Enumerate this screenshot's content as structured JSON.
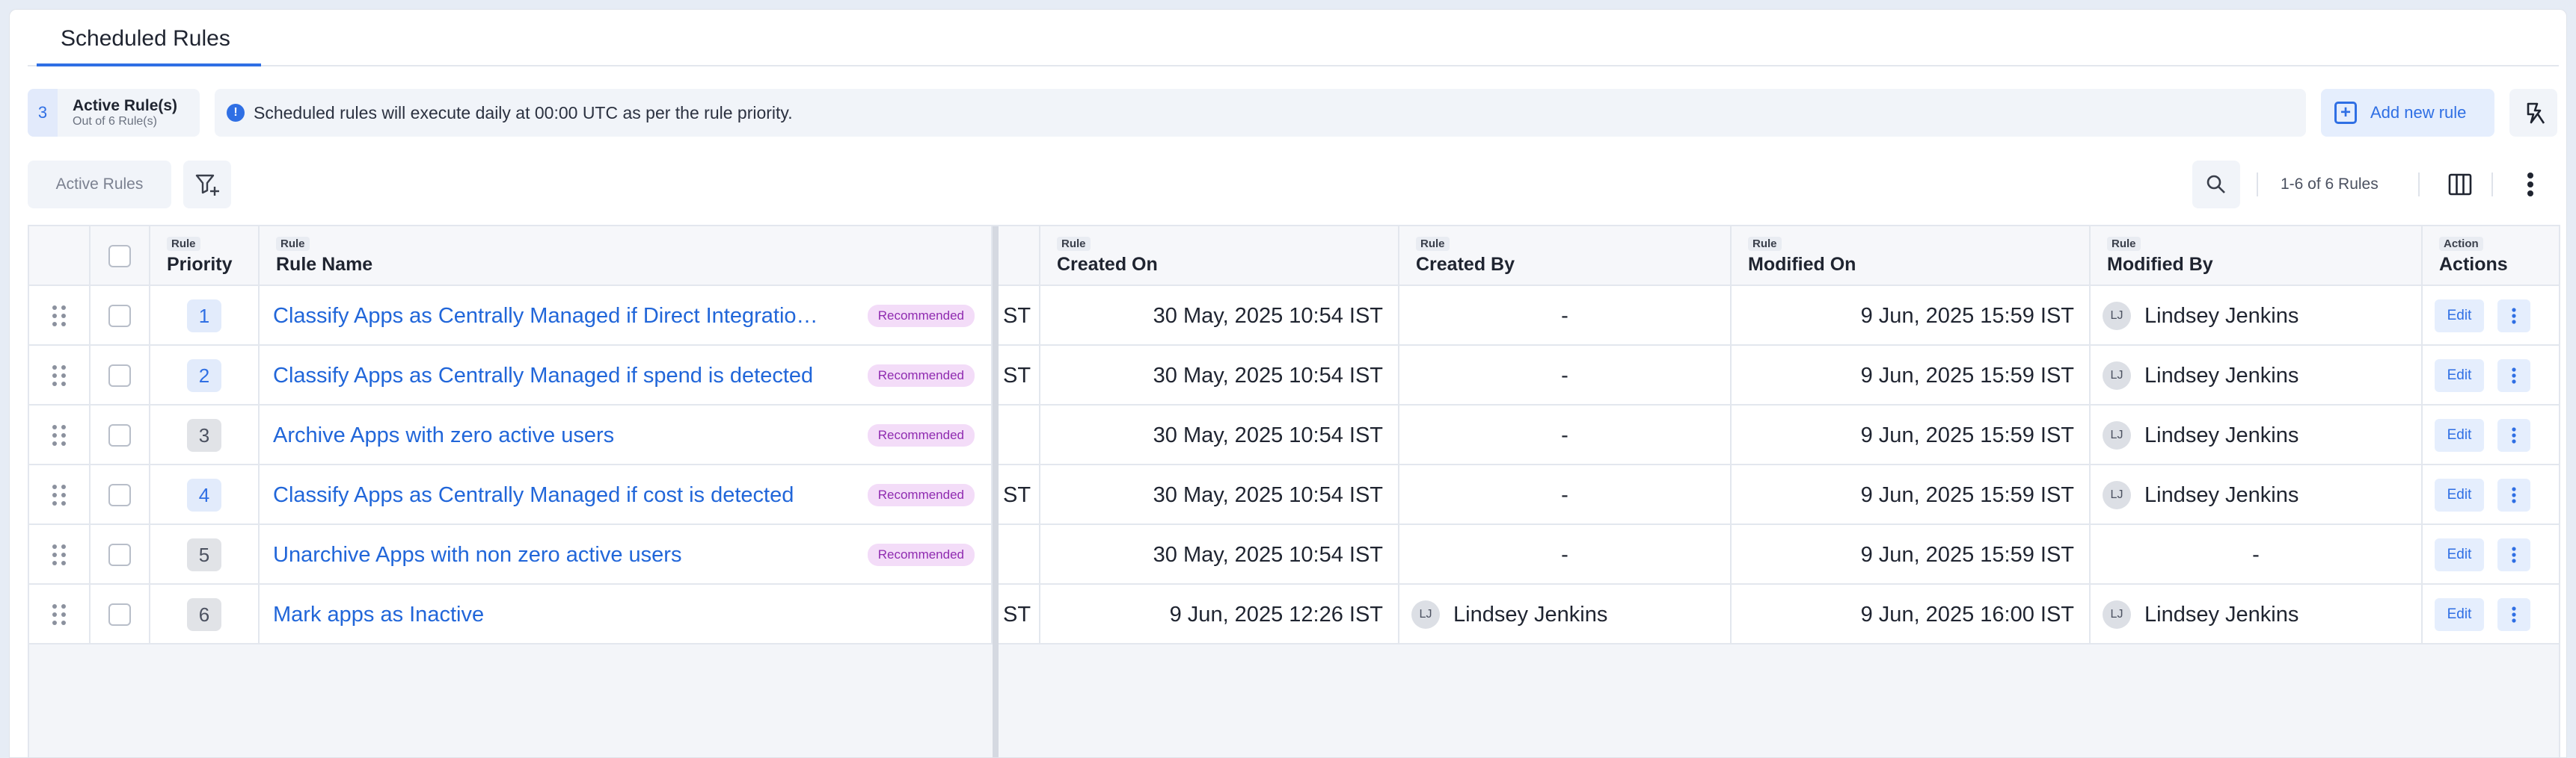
{
  "tabs": [
    {
      "label": "Scheduled Rules",
      "active": true
    }
  ],
  "summary": {
    "count": "3",
    "title": "Active Rule(s)",
    "subtitle": "Out of 6 Rule(s)"
  },
  "info": {
    "icon": "info-icon",
    "text": "Scheduled rules will execute daily at 00:00 UTC as per the rule priority."
  },
  "toolbar": {
    "add_label": "Add new rule",
    "filter_chip": "Active Rules",
    "pagination": "1-6 of 6 Rules"
  },
  "columns": {
    "priority": {
      "group": "Rule",
      "title": "Priority"
    },
    "name": {
      "group": "Rule",
      "title": "Rule Name"
    },
    "created_on": {
      "group": "Rule",
      "title": "Created On"
    },
    "created_by": {
      "group": "Rule",
      "title": "Created By"
    },
    "modified_on": {
      "group": "Rule",
      "title": "Modified On"
    },
    "modified_by": {
      "group": "Rule",
      "title": "Modified By"
    },
    "actions": {
      "group": "Action",
      "title": "Actions"
    }
  },
  "rows": [
    {
      "priority": "1",
      "active": true,
      "name": "Classify Apps as Centrally Managed if Direct Integration is present",
      "badge": "Recommended",
      "partial": "ST",
      "created_on": "30 May, 2025 10:54 IST",
      "created_by": "-",
      "created_by_initials": "",
      "modified_on": "9 Jun, 2025 15:59 IST",
      "modified_by": "Lindsey Jenkins",
      "modified_by_initials": "LJ",
      "edit": "Edit"
    },
    {
      "priority": "2",
      "active": true,
      "name": "Classify Apps as Centrally Managed if spend is detected",
      "badge": "Recommended",
      "partial": "ST",
      "created_on": "30 May, 2025 10:54 IST",
      "created_by": "-",
      "created_by_initials": "",
      "modified_on": "9 Jun, 2025 15:59 IST",
      "modified_by": "Lindsey Jenkins",
      "modified_by_initials": "LJ",
      "edit": "Edit"
    },
    {
      "priority": "3",
      "active": false,
      "name": "Archive Apps with zero active users",
      "badge": "Recommended",
      "partial": "",
      "created_on": "30 May, 2025 10:54 IST",
      "created_by": "-",
      "created_by_initials": "",
      "modified_on": "9 Jun, 2025 15:59 IST",
      "modified_by": "Lindsey Jenkins",
      "modified_by_initials": "LJ",
      "edit": "Edit"
    },
    {
      "priority": "4",
      "active": true,
      "name": "Classify Apps as Centrally Managed if cost is detected",
      "badge": "Recommended",
      "partial": "ST",
      "created_on": "30 May, 2025 10:54 IST",
      "created_by": "-",
      "created_by_initials": "",
      "modified_on": "9 Jun, 2025 15:59 IST",
      "modified_by": "Lindsey Jenkins",
      "modified_by_initials": "LJ",
      "edit": "Edit"
    },
    {
      "priority": "5",
      "active": false,
      "name": "Unarchive Apps with non zero active users",
      "badge": "Recommended",
      "partial": "",
      "created_on": "30 May, 2025 10:54 IST",
      "created_by": "-",
      "created_by_initials": "",
      "modified_on": "9 Jun, 2025 15:59 IST",
      "modified_by": "-",
      "modified_by_initials": "",
      "edit": "Edit"
    },
    {
      "priority": "6",
      "active": false,
      "name": "Mark apps as Inactive",
      "badge": "",
      "partial": "ST",
      "created_on": "9 Jun, 2025 12:26 IST",
      "created_by": "Lindsey Jenkins",
      "created_by_initials": "LJ",
      "modified_on": "9 Jun, 2025 16:00 IST",
      "modified_by": "Lindsey Jenkins",
      "modified_by_initials": "LJ",
      "edit": "Edit"
    }
  ],
  "colors": {
    "accent": "#2f6fe4",
    "link": "#2166d9",
    "badge_bg": "#f3dcf8",
    "badge_text": "#8f2bb0"
  }
}
